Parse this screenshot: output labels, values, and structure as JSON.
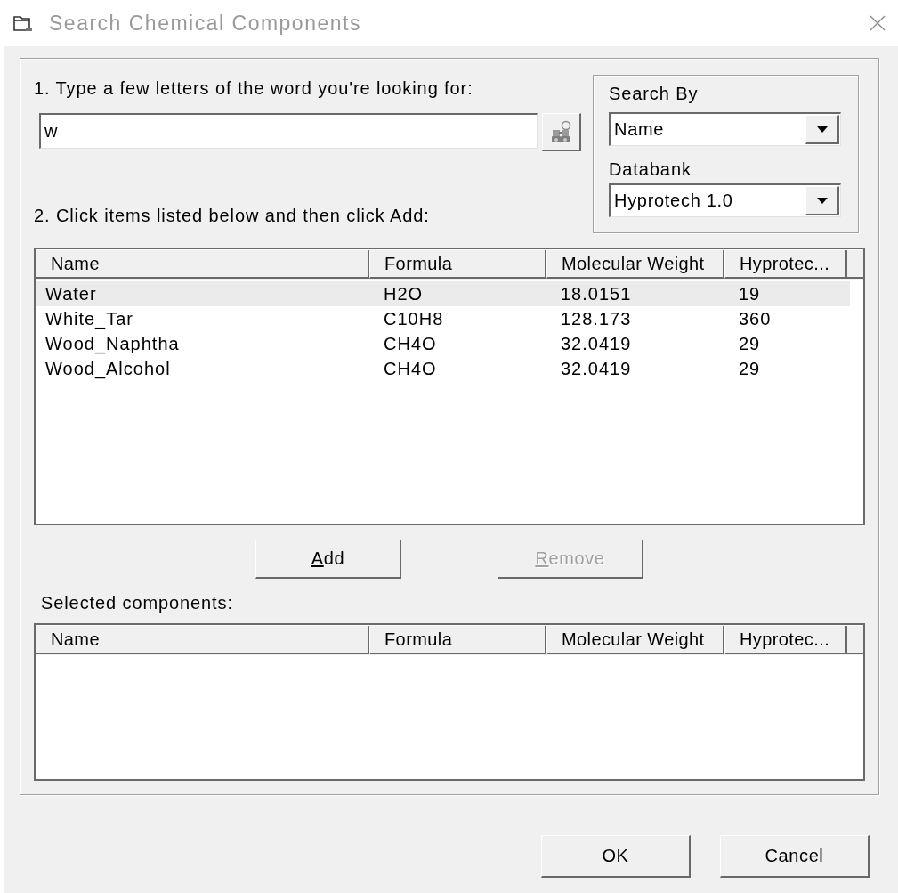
{
  "window": {
    "title": "Search Chemical Components"
  },
  "search": {
    "label": "1. Type a few letters of the word you're looking for:",
    "value": "w"
  },
  "search_by": {
    "title": "Search By",
    "value": "Name"
  },
  "databank": {
    "label": "Databank",
    "value": "Hyprotech 1.0"
  },
  "instructions": "2. Click items listed below and then click Add:",
  "results": {
    "columns": [
      "Name",
      "Formula",
      "Molecular Weight",
      "Hyprotec..."
    ],
    "rows": [
      {
        "cells": [
          "Water",
          "H2O",
          "18.0151",
          "19"
        ],
        "selected": true
      },
      {
        "cells": [
          "White_Tar",
          "C10H8",
          "128.173",
          "360"
        ],
        "selected": false
      },
      {
        "cells": [
          "Wood_Naphtha",
          "CH4O",
          "32.0419",
          "29"
        ],
        "selected": false
      },
      {
        "cells": [
          "Wood_Alcohol",
          "CH4O",
          "32.0419",
          "29"
        ],
        "selected": false
      }
    ]
  },
  "list_buttons": [
    {
      "label": "Add",
      "disabled": false,
      "mnemonic": true
    },
    {
      "label": "Remove",
      "disabled": true,
      "mnemonic": true
    }
  ],
  "selected_components": {
    "label": "Selected components:",
    "columns": [
      "Name",
      "Formula",
      "Molecular Weight",
      "Hyprotec..."
    ]
  },
  "dialog_buttons": [
    {
      "label": "OK",
      "disabled": false,
      "mnemonic": false
    },
    {
      "label": "Cancel",
      "disabled": false,
      "mnemonic": false
    }
  ]
}
